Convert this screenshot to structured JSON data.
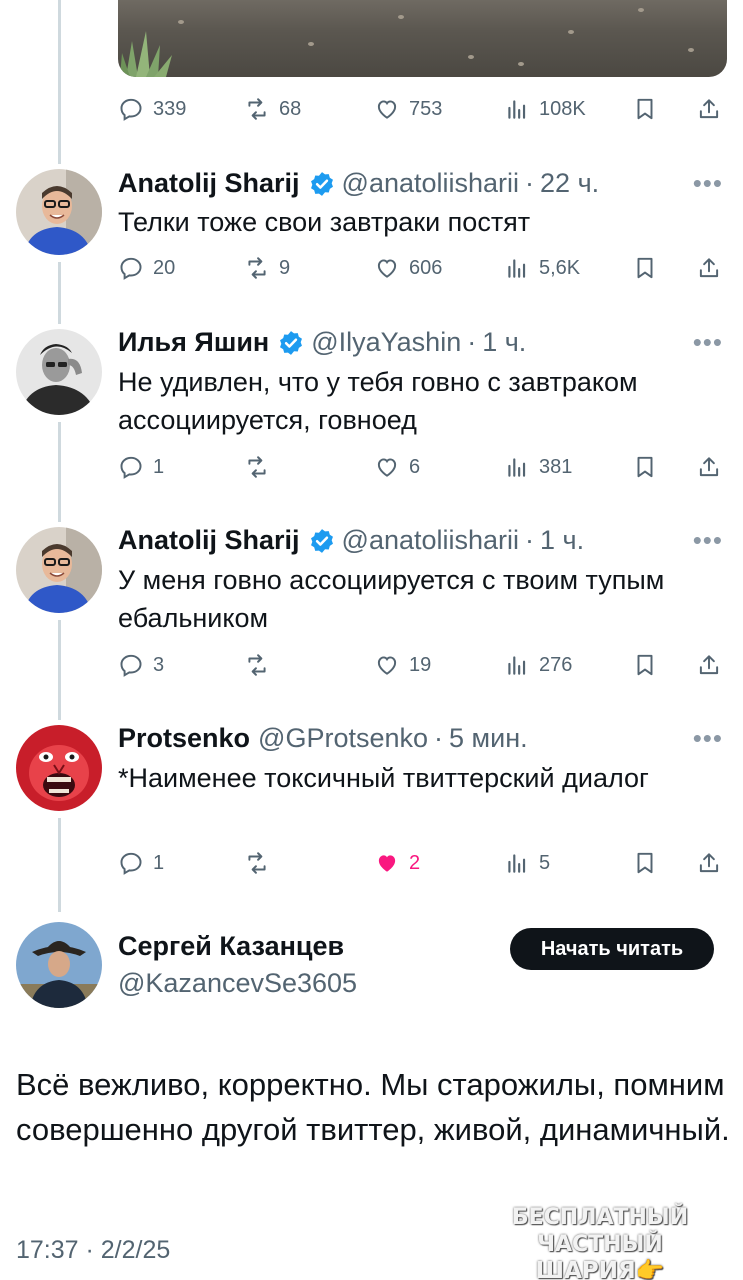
{
  "top_tweet": {
    "stats": {
      "replies": "339",
      "reposts": "68",
      "likes": "753",
      "views": "108K"
    }
  },
  "tweets": [
    {
      "name": "Anatolij Sharij",
      "verified": true,
      "handle": "@anatoliisharii",
      "time": "22 ч.",
      "text": "Телки тоже свои завтраки постят",
      "stats": {
        "replies": "20",
        "reposts": "9",
        "likes": "606",
        "views": "5,6K"
      }
    },
    {
      "name": "Илья Яшин",
      "verified": true,
      "handle": "@IlyaYashin",
      "time": "1 ч.",
      "text": "Не удивлен, что у тебя говно с завтраком ассоциируется, говноед",
      "stats": {
        "replies": "1",
        "reposts": "",
        "likes": "6",
        "views": "381"
      }
    },
    {
      "name": "Anatolij Sharij",
      "verified": true,
      "handle": "@anatoliisharii",
      "time": "1 ч.",
      "text": "У меня говно ассоциируется с твоим тупым ебальником",
      "stats": {
        "replies": "3",
        "reposts": "",
        "likes": "19",
        "views": "276"
      }
    },
    {
      "name": "Protsenko",
      "verified": false,
      "handle": "@GProtsenko",
      "time": "5 мин.",
      "text": "*Наименее токсичный твиттерский диалог",
      "stats": {
        "replies": "1",
        "reposts": "",
        "likes": "2",
        "views": "5"
      },
      "liked": true
    }
  ],
  "main_tweet": {
    "name": "Сергей Казанцев",
    "handle": "@KazancevSe3605",
    "follow_label": "Начать читать",
    "text": "Всё вежливо, корректно. Мы старожилы, помним совершенно другой твиттер, живой, динамичный.",
    "timestamp": "17:37 · 2/2/25"
  },
  "watermark": {
    "line1": "БЕСПЛАТНЫЙ ЧАСТНЫЙ",
    "line2": "ШАРИЯ👉Sharij.net"
  },
  "colors": {
    "text": "#0f1419",
    "secondary": "#536471",
    "verified": "#1d9bf0",
    "like": "#f91880",
    "thread_line": "#cfd9de"
  }
}
